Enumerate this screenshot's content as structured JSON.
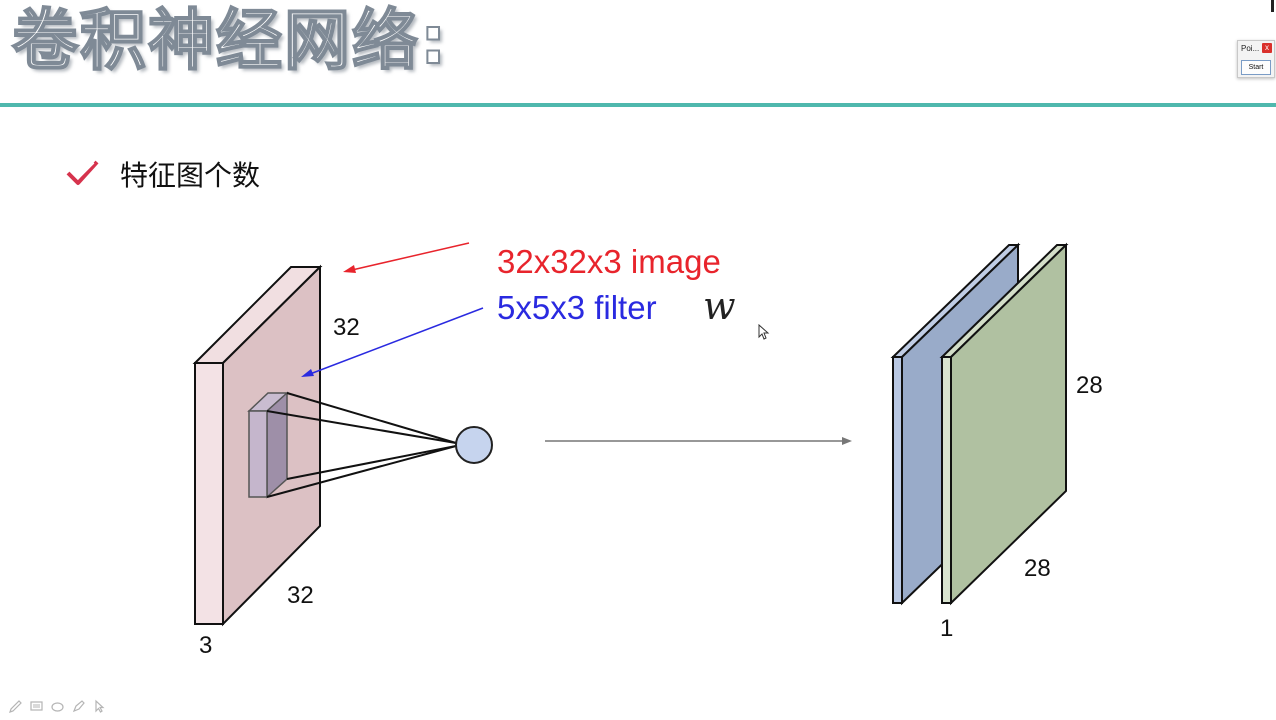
{
  "slide": {
    "title": "卷积神经网络:",
    "bullet": "特征图个数"
  },
  "diagram": {
    "image_label": "32x32x3 image",
    "filter_label": "5x5x3 filter",
    "filter_symbol": "w",
    "input_height": "32",
    "input_width": "32",
    "input_depth": "3",
    "output_height": "28",
    "output_width": "28",
    "output_depth": "1"
  },
  "widget": {
    "title": "Poi...",
    "close": "x",
    "start": "Start"
  },
  "colors": {
    "accent_rule": "#4fb8ad",
    "image_label": "#e8242c",
    "filter_label": "#2a2ae0",
    "check": "#d6334d",
    "input_volume": "#e9d1d4",
    "map_blue": "#a3b4d1",
    "map_green": "#b5c6a6"
  },
  "toolbar": {
    "icons": [
      "pen-icon",
      "screen-icon",
      "eraser-icon",
      "highlighter-icon",
      "pointer-icon"
    ]
  }
}
